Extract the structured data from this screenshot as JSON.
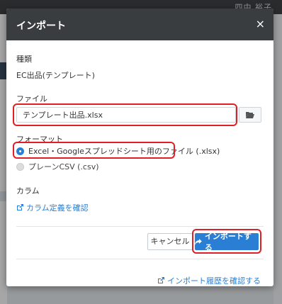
{
  "background": {
    "top_text": "四中 裕子"
  },
  "modal": {
    "title": "インポート",
    "close_label": "×",
    "type_label": "種類",
    "type_value": "EC出品(テンプレート)",
    "file_label": "ファイル",
    "file_value": "テンプレート出品.xlsx",
    "format_label": "フォーマット",
    "formats": [
      {
        "label": "Excel・Googleスプレッドシート用のファイル (.xlsx)",
        "selected": true
      },
      {
        "label": "プレーンCSV (.csv)",
        "selected": false
      }
    ],
    "column_label": "カラム",
    "column_link": "カラム定義を確認",
    "cancel_label": "キャンセル",
    "import_label": "インポートする",
    "history_link": "インポート履歴を確認する"
  },
  "icons": {
    "folder": "folder-open-icon",
    "external": "external-link-icon",
    "share": "share-arrow-icon"
  },
  "colors": {
    "accent": "#2a7fd4",
    "highlight": "#e01f26",
    "header": "#3a3d40"
  }
}
